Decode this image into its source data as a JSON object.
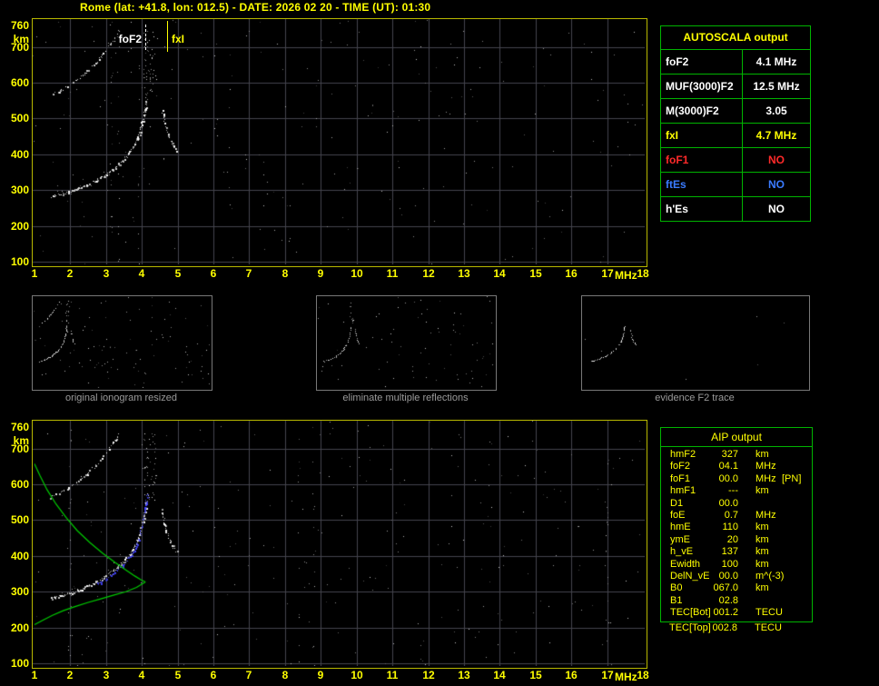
{
  "header": {
    "title": "Rome (lat: +41.8, lon: 012.5) - DATE: 2026 02 20 - TIME (UT): 01:30"
  },
  "autoscala": {
    "title": "AUTOSCALA output",
    "rows": [
      {
        "param": "foF2",
        "value": "4.1 MHz",
        "color": "#ffffff"
      },
      {
        "param": "MUF(3000)F2",
        "value": "12.5 MHz",
        "color": "#ffffff"
      },
      {
        "param": "M(3000)F2",
        "value": "3.05",
        "color": "#ffffff"
      },
      {
        "param": "fxI",
        "value": "4.7 MHz",
        "color": "#ffff00"
      },
      {
        "param": "foF1",
        "value": "NO",
        "color": "#ff2a2a"
      },
      {
        "param": "ftEs",
        "value": "NO",
        "color": "#3a7bff"
      },
      {
        "param": "h'Es",
        "value": "NO",
        "color": "#ffffff"
      }
    ]
  },
  "panels": [
    {
      "caption": "original ionogram resized"
    },
    {
      "caption": "eliminate multiple reflections"
    },
    {
      "caption": "evidence F2 trace"
    }
  ],
  "aip": {
    "title": "AIP output",
    "rows": [
      {
        "param": "hmF2",
        "value": "327",
        "unit": "km",
        "note": ""
      },
      {
        "param": "foF2",
        "value": "04.1",
        "unit": "MHz",
        "note": ""
      },
      {
        "param": "foF1",
        "value": "00.0",
        "unit": "MHz",
        "note": "[PN]"
      },
      {
        "param": "hmF1",
        "value": "---",
        "unit": "km",
        "note": ""
      },
      {
        "param": "D1",
        "value": "00.0",
        "unit": "",
        "note": ""
      },
      {
        "param": "foE",
        "value": "0.7",
        "unit": "MHz",
        "note": ""
      },
      {
        "param": "hmE",
        "value": "110",
        "unit": "km",
        "note": ""
      },
      {
        "param": "ymE",
        "value": "20",
        "unit": "km",
        "note": ""
      },
      {
        "param": "h_vE",
        "value": "137",
        "unit": "km",
        "note": ""
      },
      {
        "param": "Ewidth",
        "value": "100",
        "unit": "km",
        "note": ""
      },
      {
        "param": "DelN_vE",
        "value": "00.0",
        "unit": "m^(-3)",
        "note": ""
      },
      {
        "param": "B0",
        "value": "067.0",
        "unit": "km",
        "note": ""
      },
      {
        "param": "B1",
        "value": "02.8",
        "unit": "",
        "note": ""
      },
      {
        "param": "TEC[Bot]",
        "value": "001.2",
        "unit": "TECU",
        "note": ""
      },
      {
        "param": "TEC[Top]",
        "value": "002.8",
        "unit": "TECU",
        "note": "",
        "outside": true
      }
    ]
  },
  "chart_data": {
    "type": "scatter",
    "title": "Ionogram - Rome - 2026 02 20 01:30 UT",
    "xlabel": "MHz",
    "ylabel": "km",
    "xlim": [
      1,
      18
    ],
    "ylim": [
      100,
      760
    ],
    "grid": true,
    "x_ticks": [
      1,
      2,
      3,
      4,
      5,
      6,
      7,
      8,
      9,
      10,
      11,
      12,
      13,
      14,
      15,
      16,
      17,
      18
    ],
    "y_ticks": [
      760,
      700,
      600,
      500,
      400,
      300,
      200,
      100
    ],
    "markers": [
      {
        "id": "fof2",
        "label": "foF2",
        "x": 4.1,
        "color": "#ffffff",
        "side": "left",
        "line": "dashed"
      },
      {
        "id": "fxi",
        "label": "fxI",
        "x": 4.7,
        "color": "#ffff00",
        "side": "right",
        "line": "solid"
      }
    ],
    "series": [
      {
        "id": "f2_trace",
        "name": "F2 layer O-mode echo trace",
        "color": "#ffffff",
        "render": "dots",
        "density": 0.95,
        "halo": true,
        "points": [
          [
            1.45,
            283
          ],
          [
            1.7,
            289
          ],
          [
            1.95,
            296
          ],
          [
            2.2,
            305
          ],
          [
            2.45,
            315
          ],
          [
            2.7,
            327
          ],
          [
            2.95,
            342
          ],
          [
            3.2,
            360
          ],
          [
            3.45,
            382
          ],
          [
            3.65,
            405
          ],
          [
            3.82,
            432
          ],
          [
            3.93,
            462
          ],
          [
            4.02,
            495
          ],
          [
            4.08,
            525
          ],
          [
            4.12,
            552
          ]
        ]
      },
      {
        "id": "x_trace",
        "name": "F2 layer X-mode echo trace",
        "color": "#ffffff",
        "render": "dots",
        "density": 0.85,
        "points": [
          [
            4.55,
            528
          ],
          [
            4.62,
            492
          ],
          [
            4.7,
            463
          ],
          [
            4.78,
            442
          ],
          [
            4.87,
            426
          ],
          [
            4.97,
            413
          ]
        ]
      },
      {
        "id": "second_hop",
        "name": "Second-hop multiple reflection",
        "color": "#ffffff",
        "render": "dots",
        "density": 0.7,
        "points": [
          [
            1.45,
            566
          ],
          [
            1.7,
            578
          ],
          [
            1.95,
            592
          ],
          [
            2.2,
            610
          ],
          [
            2.45,
            630
          ],
          [
            2.7,
            654
          ],
          [
            2.95,
            684
          ],
          [
            3.2,
            718
          ],
          [
            3.35,
            744
          ]
        ]
      },
      {
        "id": "spread_f",
        "name": "Spread echoes near foF2",
        "color": "#e8e8e8",
        "render": "cloud",
        "points": [
          [
            4.0,
            555
          ],
          [
            4.4,
            750
          ]
        ]
      },
      {
        "id": "restored_trace",
        "name": "Autoscala restored F2 trace",
        "color": "#4646ff",
        "render": "dots",
        "density": 0.9,
        "points": [
          [
            2.75,
            322
          ],
          [
            3.0,
            337
          ],
          [
            3.25,
            356
          ],
          [
            3.5,
            378
          ],
          [
            3.7,
            402
          ],
          [
            3.85,
            430
          ],
          [
            3.96,
            465
          ],
          [
            4.04,
            505
          ],
          [
            4.1,
            545
          ],
          [
            4.14,
            575
          ]
        ]
      },
      {
        "id": "profile_topside",
        "name": "Electron density profile (topside)",
        "color": "#00cc00",
        "render": "line",
        "points": [
          [
            1.0,
            657
          ],
          [
            1.15,
            625
          ],
          [
            1.35,
            585
          ],
          [
            1.6,
            545
          ],
          [
            1.9,
            505
          ],
          [
            2.2,
            470
          ],
          [
            2.55,
            437
          ],
          [
            2.9,
            408
          ],
          [
            3.25,
            382
          ],
          [
            3.55,
            361
          ],
          [
            3.8,
            344
          ],
          [
            3.98,
            333
          ],
          [
            4.1,
            327
          ]
        ]
      },
      {
        "id": "profile_bottomside",
        "name": "Electron density profile (bottomside)",
        "color": "#00cc00",
        "render": "line",
        "points": [
          [
            4.1,
            327
          ],
          [
            3.85,
            312
          ],
          [
            3.55,
            300
          ],
          [
            3.2,
            290
          ],
          [
            2.85,
            280
          ],
          [
            2.5,
            270
          ],
          [
            2.15,
            259
          ],
          [
            1.8,
            247
          ],
          [
            1.5,
            234
          ],
          [
            1.25,
            221
          ],
          [
            1.0,
            208
          ]
        ]
      }
    ]
  }
}
